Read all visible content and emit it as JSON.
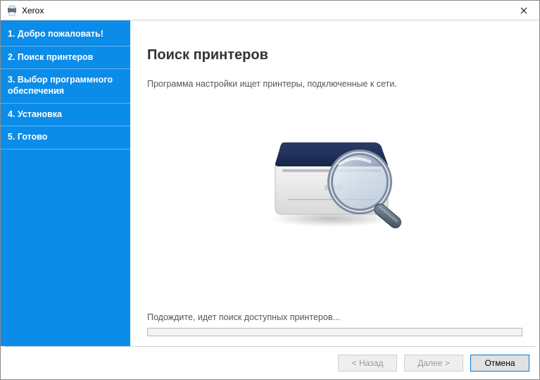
{
  "window": {
    "title": "Xerox"
  },
  "sidebar": {
    "items": [
      {
        "label": "1. Добро пожаловать!"
      },
      {
        "label": "2. Поиск принтеров"
      },
      {
        "label": "3. Выбор программного обеспечения"
      },
      {
        "label": "4. Установка"
      },
      {
        "label": "5. Готово"
      }
    ]
  },
  "content": {
    "heading": "Поиск принтеров",
    "subheading": "Программа настройки ищет принтеры, подключенные к сети.",
    "wait_text": "Подождите, идет поиск доступных принтеров..."
  },
  "buttons": {
    "back": "< Назад",
    "next": "Далее >",
    "cancel": "Отмена"
  },
  "colors": {
    "sidebar_bg": "#0c8ce9",
    "accent": "#0078d7"
  }
}
